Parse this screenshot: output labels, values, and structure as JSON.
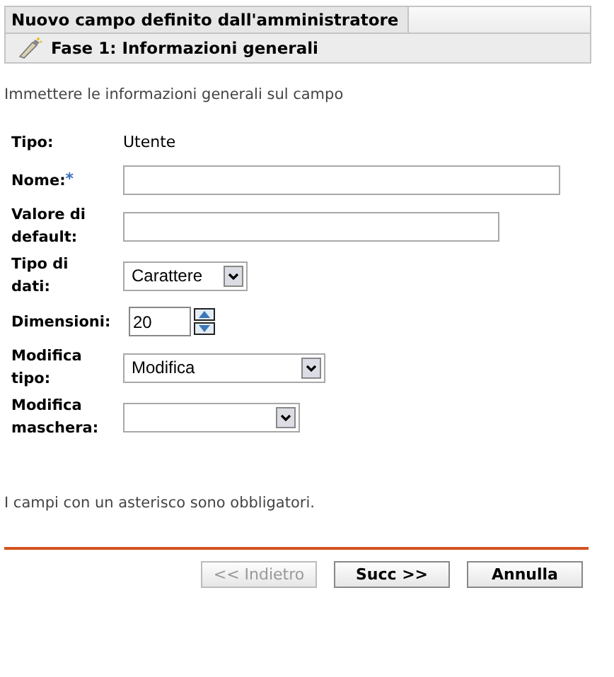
{
  "header": {
    "title": "Nuovo campo definito dall'amministratore",
    "step": "Fase 1: Informazioni generali"
  },
  "intro": "Immettere le informazioni generali sul campo",
  "fields": [
    {
      "kind": "text",
      "label": "Tipo:",
      "value": "Utente"
    },
    {
      "kind": "input",
      "label": "Nome:",
      "required_mark": "*"
    },
    {
      "kind": "input",
      "label": "Valore di default:"
    },
    {
      "kind": "select",
      "label": "Tipo di dati:",
      "value": "Carattere"
    },
    {
      "kind": "spinner",
      "label": "Dimensioni:",
      "value": "20"
    },
    {
      "kind": "select",
      "label": "Modifica tipo:",
      "value": "Modifica"
    },
    {
      "kind": "select",
      "label": "Modifica maschera:"
    }
  ],
  "footnote": "I campi con un asterisco sono obbligatori.",
  "buttons": [
    {
      "label": "<< Indietro",
      "disabled": true
    },
    {
      "label": "Succ >>",
      "disabled": false
    },
    {
      "label": "Annulla",
      "disabled": false
    }
  ]
}
